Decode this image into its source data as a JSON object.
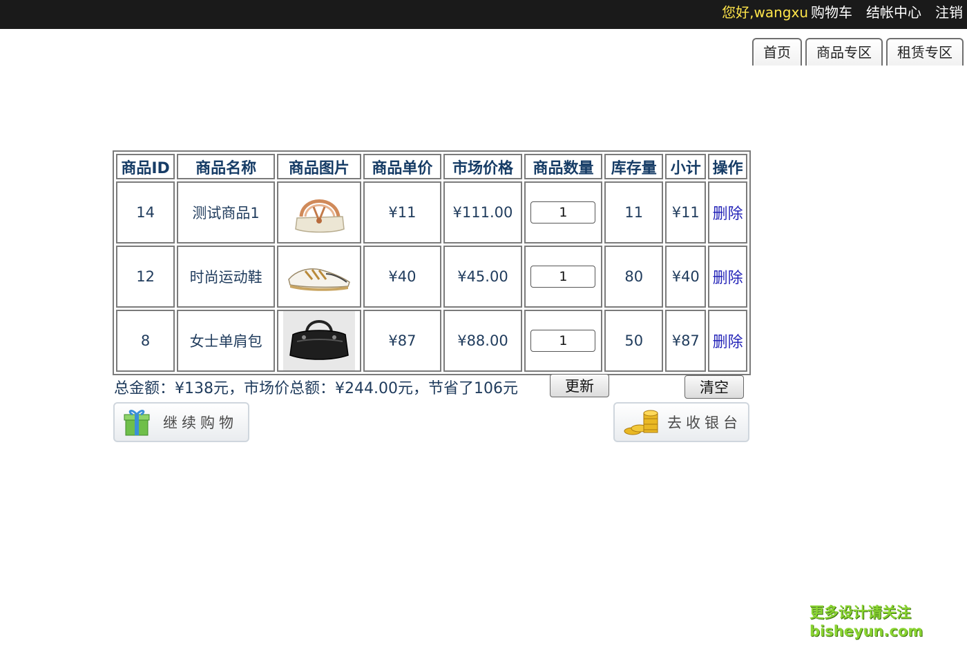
{
  "topbar": {
    "greeting": "您好,wangxu",
    "links": [
      "购物车",
      "结帐中心",
      "注销"
    ]
  },
  "tabs": [
    "首页",
    "商品专区",
    "租赁专区"
  ],
  "table": {
    "headers": [
      "商品ID",
      "商品名称",
      "商品图片",
      "商品单价",
      "市场价格",
      "商品数量",
      "库存量",
      "小计",
      "操作"
    ],
    "rows": [
      {
        "id": "14",
        "name": "测试商品1",
        "image": "handbag-image",
        "price": "¥11",
        "market": "¥111.00",
        "qty": "1",
        "stock": "11",
        "subtotal": "¥11",
        "action": "删除"
      },
      {
        "id": "12",
        "name": "时尚运动鞋",
        "image": "sneaker-image",
        "price": "¥40",
        "market": "¥45.00",
        "qty": "1",
        "stock": "80",
        "subtotal": "¥40",
        "action": "删除"
      },
      {
        "id": "8",
        "name": "女士单肩包",
        "image": "shoulder-bag-image",
        "price": "¥87",
        "market": "¥88.00",
        "qty": "1",
        "stock": "50",
        "subtotal": "¥87",
        "action": "删除"
      }
    ]
  },
  "summary": {
    "text": "总金额：¥138元，市场价总额：¥244.00元，节省了106元",
    "update_label": "更新",
    "clear_label": "清空"
  },
  "actions": {
    "continue_label": "继续购物",
    "checkout_label": "去收银台"
  },
  "watermark": {
    "line1": "更多设计请关注",
    "line2": "bisheyun.com"
  }
}
